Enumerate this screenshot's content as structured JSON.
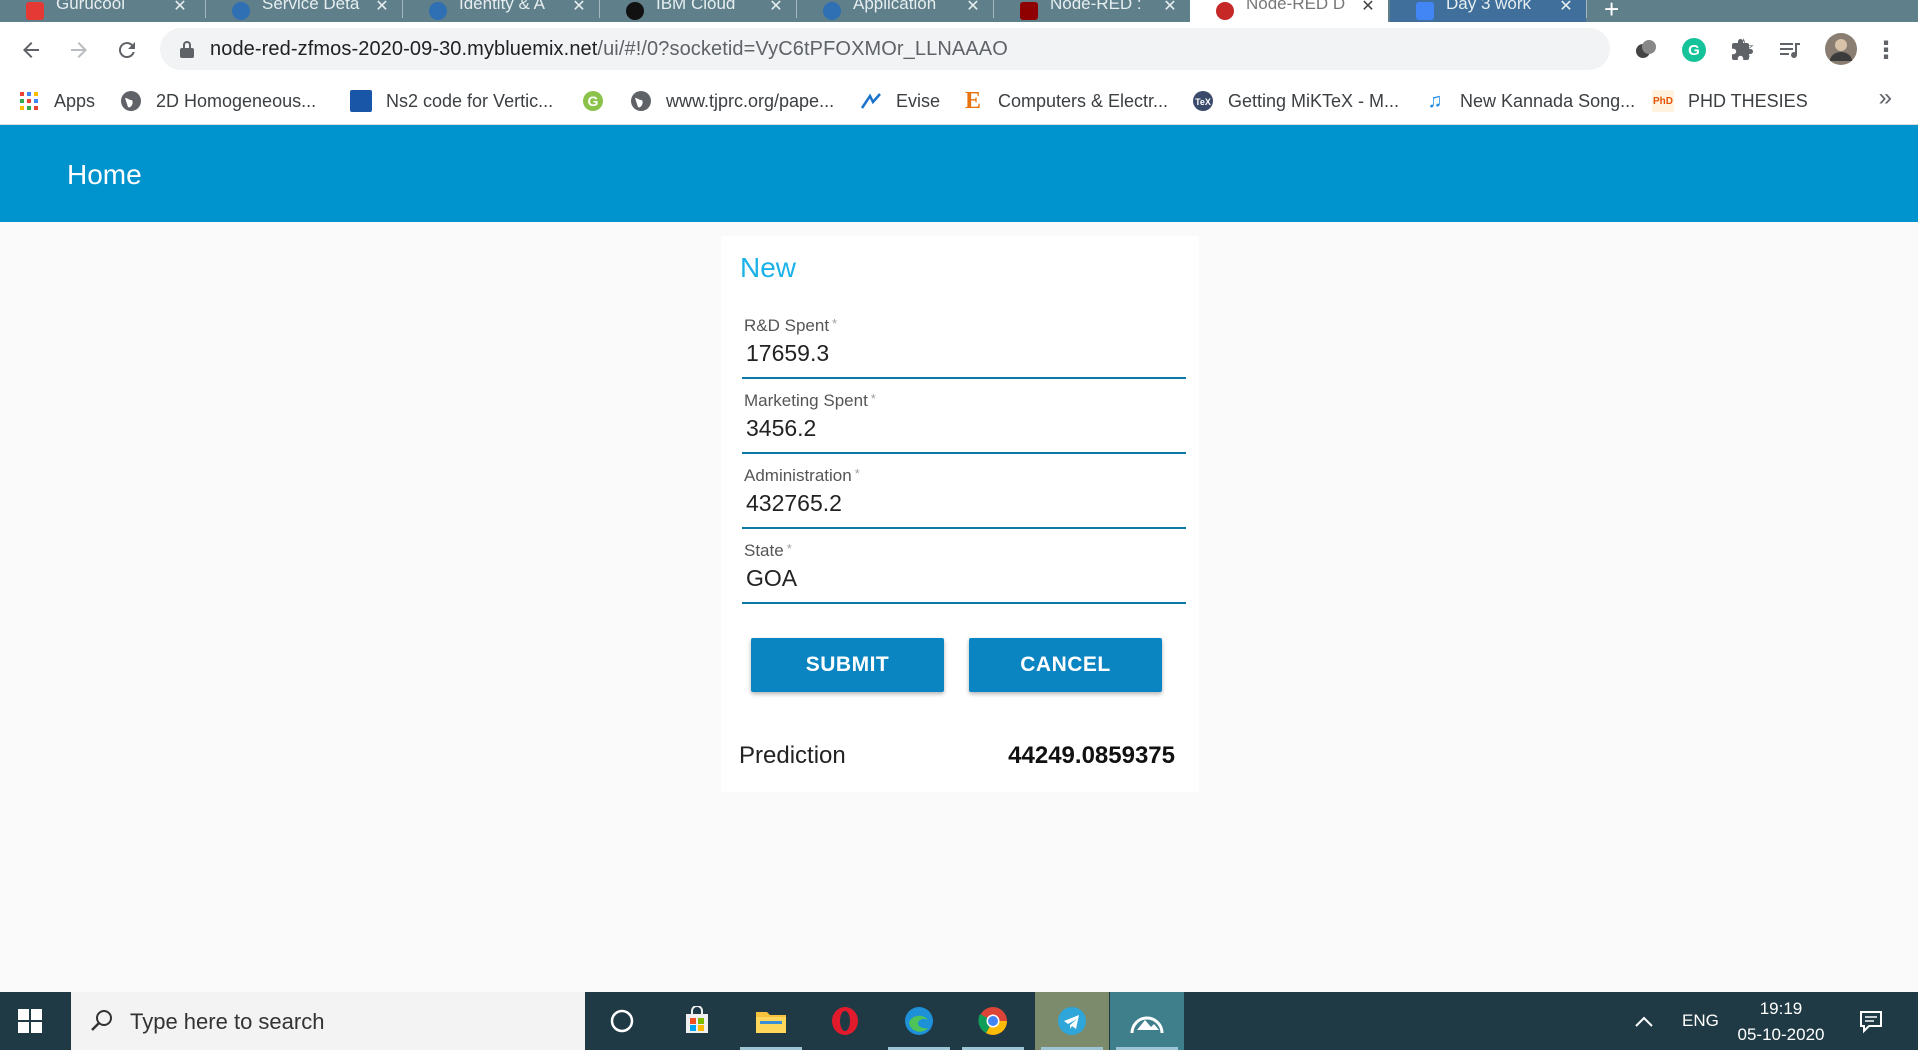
{
  "browser": {
    "tabs": [
      {
        "title": "Gurucool",
        "favicon_color": "#e53935"
      },
      {
        "title": "Service Deta",
        "favicon_color": "#2f6fb3"
      },
      {
        "title": "Identity & A",
        "favicon_color": "#2f6fb3"
      },
      {
        "title": "IBM Cloud",
        "favicon_color": "#111111"
      },
      {
        "title": "Application",
        "favicon_color": "#2f6fb3"
      },
      {
        "title": "Node-RED :",
        "favicon_color": "#8f0000"
      },
      {
        "title": "Node-RED D",
        "favicon_color": "#c62828"
      },
      {
        "title": "Day 3 work",
        "favicon_color": "#4285f4"
      }
    ],
    "tab_close_glyph": "✕",
    "new_tab_glyph": "+",
    "url_host": "node-red-zfmos-2020-09-30.mybluemix.net",
    "url_path": "/ui/#!/0?socketid=VyC6tPFOXMOr_LLNAAAO",
    "bookmarks": [
      {
        "label": "Apps",
        "icon": "apps-grid-icon"
      },
      {
        "label": "2D Homogeneous...",
        "icon": "globe-icon"
      },
      {
        "label": "Ns2 code for Vertic...",
        "icon": "ns2-thumbnail-icon"
      },
      {
        "label": "",
        "icon": "green-g-icon"
      },
      {
        "label": "www.tjprc.org/pape...",
        "icon": "globe-icon"
      },
      {
        "label": "Evise",
        "icon": "evise-icon"
      },
      {
        "label": "Computers & Electr...",
        "icon": "elsevier-e-icon"
      },
      {
        "label": "Getting MiKTeX - M...",
        "icon": "miktex-icon"
      },
      {
        "label": "New Kannada Song...",
        "icon": "music-note-icon"
      },
      {
        "label": "PHD THESIES",
        "icon": "phd-icon"
      }
    ],
    "bookmarks_overflow": "»"
  },
  "dashboard": {
    "page_title": "Home",
    "card_title": "New",
    "required_mark": "*",
    "fields": [
      {
        "label": "R&D Spent",
        "value": "17659.3"
      },
      {
        "label": "Marketing Spent",
        "value": "3456.2"
      },
      {
        "label": "Administration",
        "value": "432765.2"
      },
      {
        "label": "State",
        "value": "GOA"
      }
    ],
    "submit_label": "SUBMIT",
    "cancel_label": "CANCEL",
    "prediction_label": "Prediction",
    "prediction_value": "44249.0859375",
    "accent_color": "#0094ce",
    "title_color": "#1bb2e8"
  },
  "taskbar": {
    "search_placeholder": "Type here to search",
    "language": "ENG",
    "time": "19:19",
    "date": "05-10-2020"
  }
}
